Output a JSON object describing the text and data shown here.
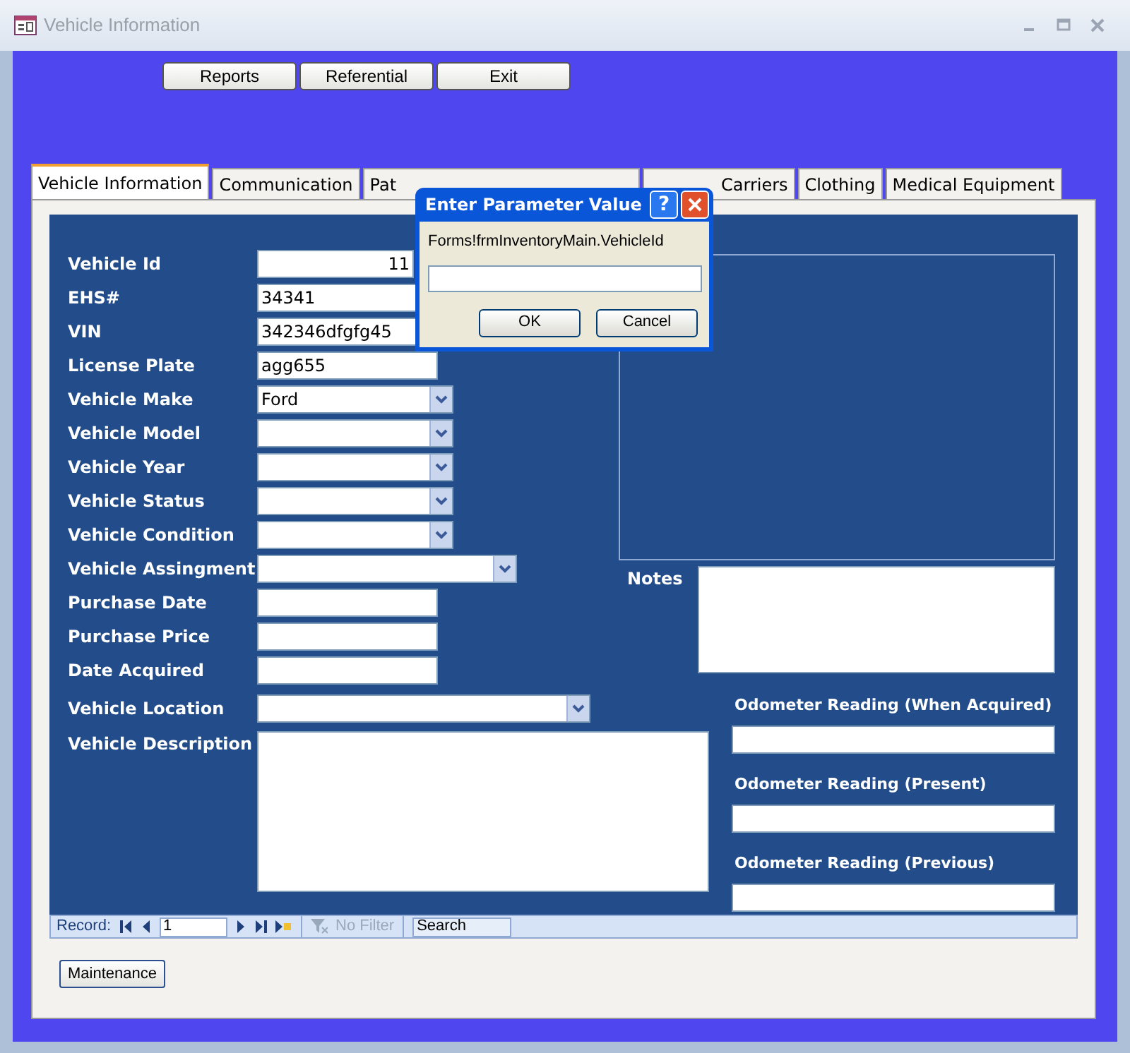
{
  "window": {
    "title": "Vehicle Information"
  },
  "header_buttons": [
    "Reports",
    "Referential",
    "Exit"
  ],
  "tabs": [
    {
      "label": "Vehicle Information",
      "selected": true
    },
    {
      "label": "Communication",
      "selected": false
    },
    {
      "label": "Pat",
      "selected": false
    },
    {
      "label": "Carriers",
      "selected": false
    },
    {
      "label": "Clothing",
      "selected": false
    },
    {
      "label": "Medical Equipment",
      "selected": false
    }
  ],
  "fields": [
    {
      "label": "Vehicle Id",
      "kind": "number",
      "value": "11"
    },
    {
      "label": "EHS#",
      "kind": "text",
      "value": "34341"
    },
    {
      "label": "VIN",
      "kind": "text",
      "value": "342346dfgfg45"
    },
    {
      "label": "License Plate",
      "kind": "text",
      "value": "agg655"
    },
    {
      "label": "Vehicle Make",
      "kind": "combo",
      "value": "Ford"
    },
    {
      "label": "Vehicle Model",
      "kind": "combo"
    },
    {
      "label": "Vehicle Year",
      "kind": "combo"
    },
    {
      "label": "Vehicle Status",
      "kind": "combo"
    },
    {
      "label": "Vehicle Condition",
      "kind": "combo"
    },
    {
      "label": "Vehicle Assingment",
      "kind": "combo-wide"
    },
    {
      "label": "Purchase Date",
      "kind": "text"
    },
    {
      "label": "Purchase Price",
      "kind": "text"
    },
    {
      "label": "Date Acquired",
      "kind": "text"
    }
  ],
  "location": {
    "label": "Vehicle Location"
  },
  "description": {
    "label": "Vehicle Description"
  },
  "notes": {
    "label": "Notes"
  },
  "odometers": [
    "Odometer Reading (When Acquired)",
    "Odometer Reading (Present)",
    "Odometer Reading (Previous)"
  ],
  "navigation": {
    "label": "Record:",
    "value": "1",
    "filter": "No Filter",
    "search_placeholder": "Search"
  },
  "footer_button": "Maintenance",
  "dialog": {
    "title": "Enter Parameter Value",
    "help": "?",
    "prompt": "Forms!frmInventoryMain.VehicleId",
    "buttons": [
      "OK",
      "Cancel"
    ]
  }
}
